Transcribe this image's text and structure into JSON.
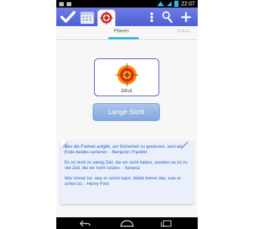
{
  "status_bar": {
    "time": "22:07"
  },
  "toolbar": {
    "icons": [
      "check-icon",
      "calendar-icon",
      "target-icon",
      "more-vertical-icon",
      "search-icon",
      "plus-icon"
    ]
  },
  "tabs": {
    "active": "Planen",
    "next": "Fokus"
  },
  "goal_card": {
    "label": "ZIELE"
  },
  "long_term_button": {
    "label": "Lange Sicht"
  },
  "quotes": [
    "Wer die Freiheit aufgibt, um Sicherheit zu gewinnen, wird am Ende beides verlieren. - Benjamin Franklin",
    "Es ist nicht zu wenig Zeit, die wir nicht haben, sondern es ist zu viel Zeit, die wir nicht nutzen. - Seneca",
    "Wer immer tut, was er schon kann, bleibt immer das, was er schon ist. - Henry Ford"
  ],
  "colors": {
    "accent": "#33b5e5",
    "action_bar": "#5a69dc",
    "quote_text": "#2c58c7",
    "button": "#95b4e6"
  }
}
